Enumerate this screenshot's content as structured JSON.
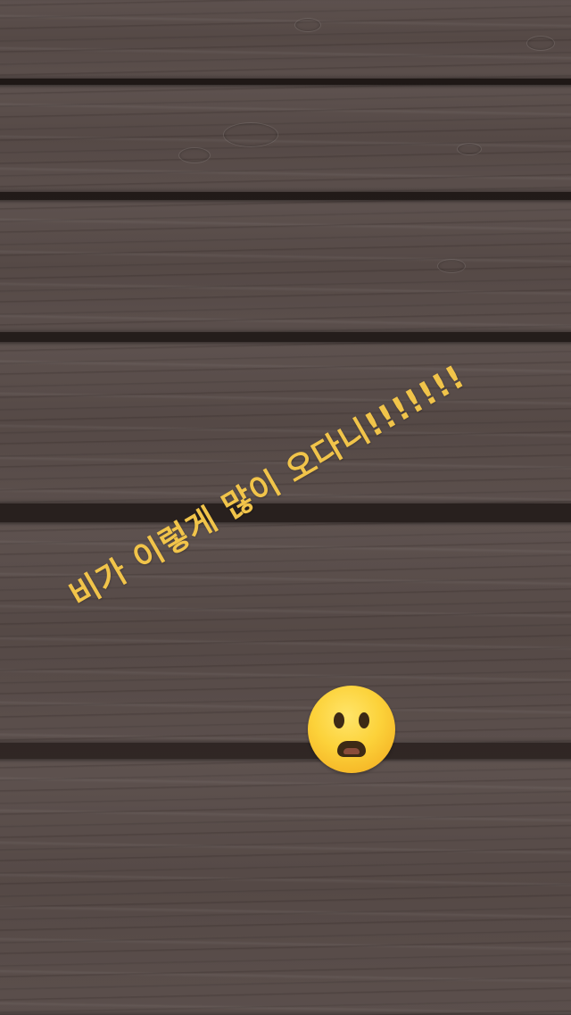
{
  "story": {
    "caption": "비가 이렇게 많이 오다니!!!!!!!",
    "caption_color": "#f1c44a",
    "emoji": "frowning-face-with-open-mouth"
  },
  "background": {
    "subject": "wet-wooden-deck",
    "wood_color": "#5a4e4b",
    "gap_color": "#211a18"
  }
}
